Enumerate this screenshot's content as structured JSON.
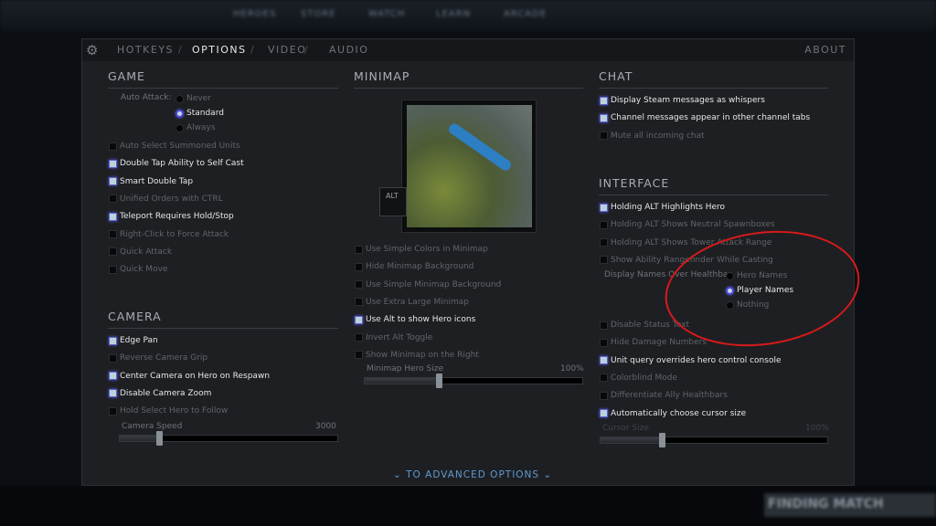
{
  "background": {
    "top_nav": [
      "HEROES",
      "STORE",
      "WATCH",
      "LEARN",
      "ARCADE"
    ],
    "finding_match": "FINDING MATCH"
  },
  "tabs": [
    {
      "label": "HOTKEYS",
      "active": false
    },
    {
      "label": "OPTIONS",
      "active": true
    },
    {
      "label": "VIDEO",
      "active": false
    },
    {
      "label": "AUDIO",
      "active": false
    }
  ],
  "tab_separator": "/",
  "about": "ABOUT",
  "game": {
    "title": "GAME",
    "auto_attack_label": "Auto Attack:",
    "auto_attack_options": [
      {
        "label": "Never",
        "selected": false
      },
      {
        "label": "Standard",
        "selected": true
      },
      {
        "label": "Always",
        "selected": false
      }
    ],
    "checkboxes": [
      {
        "label": "Auto Select Summoned Units",
        "checked": false
      },
      {
        "label": "Double Tap Ability to Self Cast",
        "checked": true
      },
      {
        "label": "Smart Double Tap",
        "checked": true
      },
      {
        "label": "Unified Orders with CTRL",
        "checked": false
      },
      {
        "label": "Teleport Requires Hold/Stop",
        "checked": true
      },
      {
        "label": "Right-Click to Force Attack",
        "checked": false
      },
      {
        "label": "Quick Attack",
        "checked": false
      },
      {
        "label": "Quick Move",
        "checked": false
      }
    ]
  },
  "camera": {
    "title": "CAMERA",
    "checkboxes": [
      {
        "label": "Edge Pan",
        "checked": true
      },
      {
        "label": "Reverse Camera Grip",
        "checked": false
      },
      {
        "label": "Center Camera on Hero on Respawn",
        "checked": true
      },
      {
        "label": "Disable Camera Zoom",
        "checked": true
      },
      {
        "label": "Hold Select Hero to Follow",
        "checked": false
      }
    ],
    "speed_label": "Camera Speed",
    "speed_value": "3000",
    "speed_fraction": 0.18
  },
  "minimap": {
    "title": "MINIMAP",
    "alt_key": "ALT",
    "checkboxes": [
      {
        "label": "Use Simple Colors in Minimap",
        "checked": false
      },
      {
        "label": "Hide Minimap Background",
        "checked": false
      },
      {
        "label": "Use Simple Minimap Background",
        "checked": false
      },
      {
        "label": "Use Extra Large Minimap",
        "checked": false
      },
      {
        "label": "Use Alt to show Hero icons",
        "checked": true
      },
      {
        "label": "Invert Alt Toggle",
        "checked": false
      },
      {
        "label": "Show Minimap on the Right",
        "checked": false
      }
    ],
    "hero_size_label": "Minimap Hero Size",
    "hero_size_value": "100%",
    "hero_size_fraction": 0.34
  },
  "chat": {
    "title": "CHAT",
    "checkboxes": [
      {
        "label": "Display Steam messages as whispers",
        "checked": true
      },
      {
        "label": "Channel messages appear in other channel tabs",
        "checked": true
      },
      {
        "label": "Mute all incoming chat",
        "checked": false
      }
    ]
  },
  "interface": {
    "title": "INTERFACE",
    "checkboxes_top": [
      {
        "label": "Holding ALT Highlights Hero",
        "checked": true
      },
      {
        "label": "Holding ALT Shows Neutral Spawnboxes",
        "checked": false
      },
      {
        "label": "Holding ALT Shows Tower Attack Range",
        "checked": false
      },
      {
        "label": "Show Ability Rangefinder While Casting",
        "checked": false
      }
    ],
    "names_label": "Display Names Over Healthbar",
    "names_options": [
      {
        "label": "Hero Names",
        "selected": false
      },
      {
        "label": "Player Names",
        "selected": true
      },
      {
        "label": "Nothing",
        "selected": false
      }
    ],
    "checkboxes_bottom": [
      {
        "label": "Disable Status Text",
        "checked": false
      },
      {
        "label": "Hide Damage Numbers",
        "checked": false
      },
      {
        "label": "Unit query overrides hero control console",
        "checked": true
      },
      {
        "label": "Colorblind Mode",
        "checked": false
      },
      {
        "label": "Differentiate Ally Healthbars",
        "checked": false
      },
      {
        "label": "Automatically choose cursor size",
        "checked": true
      }
    ],
    "cursor_label": "Cursor Size",
    "cursor_value": "100%",
    "cursor_fraction": 0.27
  },
  "advanced": "TO ADVANCED OPTIONS",
  "colors": {
    "accent": "#5659d9",
    "link": "#5d9bd0",
    "annotation": "#d61a1a"
  }
}
